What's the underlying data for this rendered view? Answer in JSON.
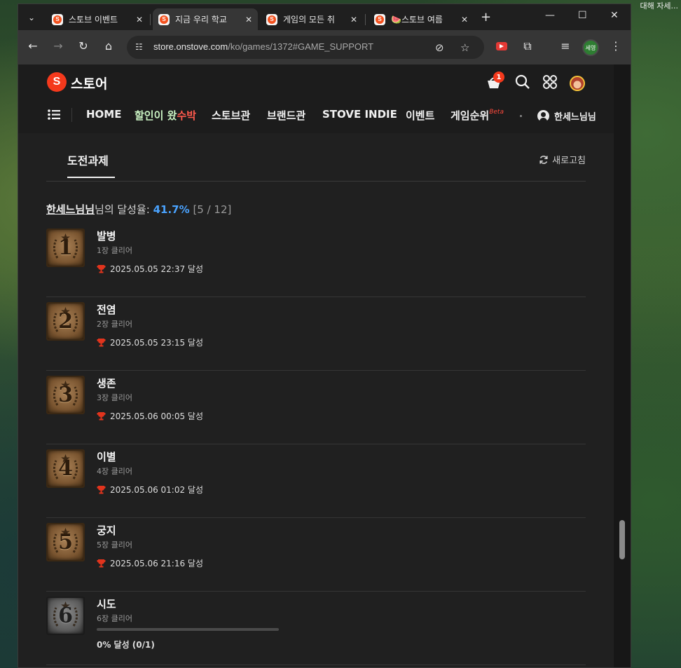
{
  "desktop": {
    "corner_text": "대해 자세..."
  },
  "browser": {
    "tabs": [
      {
        "title": "스토브 이벤트",
        "active": false
      },
      {
        "title": "지금 우리 학교",
        "active": true
      },
      {
        "title": "게임의 모든 취",
        "active": false
      },
      {
        "title": "🍉스토브 여름",
        "active": false
      }
    ],
    "url_host": "store.onstove.com",
    "url_path": "/ko/games/1372#GAME_SUPPORT",
    "profile_label": "세영"
  },
  "site": {
    "logo_letter": "S",
    "logo_text": "스토어",
    "cart_count": "1",
    "nav": {
      "home": "HOME",
      "sale_a": "할인이 왔",
      "sale_b": "수박",
      "stove_hall": "스토브관",
      "brand_hall": "브랜드관",
      "indie": "STOVE INDIE",
      "event": "이벤트",
      "ranking": "게임순위",
      "ranking_badge": "Beta",
      "user": "한세느님님"
    }
  },
  "achievements": {
    "tab_label": "도전과제",
    "refresh_label": "새로고침",
    "summary": {
      "user": "한세느님님",
      "suffix": "님의 달성율: ",
      "percent": "41.7%",
      "count": "[5 / 12]"
    },
    "items": [
      {
        "number": "1",
        "name": "발병",
        "desc": "1장 클리어",
        "status": "2025.05.05 22:37 달성",
        "locked": false
      },
      {
        "number": "2",
        "name": "전염",
        "desc": "2장 클리어",
        "status": "2025.05.05 23:15 달성",
        "locked": false
      },
      {
        "number": "3",
        "name": "생존",
        "desc": "3장 클리어",
        "status": "2025.05.06 00:05 달성",
        "locked": false
      },
      {
        "number": "4",
        "name": "이별",
        "desc": "4장 클리어",
        "status": "2025.05.06 01:02 달성",
        "locked": false
      },
      {
        "number": "5",
        "name": "궁지",
        "desc": "5장 클리어",
        "status": "2025.05.06 21:16 달성",
        "locked": false
      },
      {
        "number": "6",
        "name": "시도",
        "desc": "6장 클리어",
        "progress_text": "0% 달성 (0/1)",
        "progress": 0,
        "locked": true
      }
    ]
  },
  "colors": {
    "accent": "#4aa3ff",
    "brand": "#f4391c",
    "trophy": "#e2341d"
  }
}
